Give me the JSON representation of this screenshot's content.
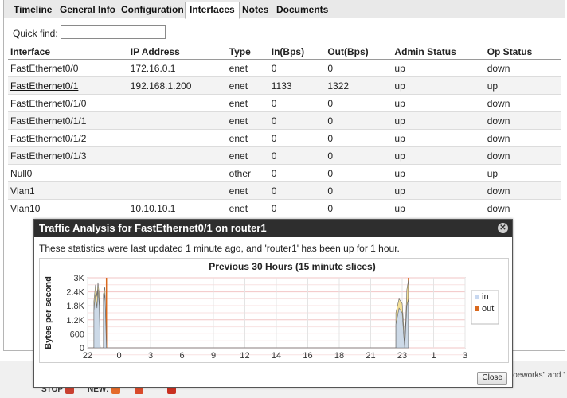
{
  "tabs": [
    {
      "label": "Timeline"
    },
    {
      "label": "General Info"
    },
    {
      "label": "Configuration"
    },
    {
      "label": "Interfaces",
      "active": true
    },
    {
      "label": "Notes"
    },
    {
      "label": "Documents"
    }
  ],
  "quickfind": {
    "label": "Quick find:",
    "value": ""
  },
  "table": {
    "headers": [
      "Interface",
      "IP Address",
      "Type",
      "In(Bps)",
      "Out(Bps)",
      "Admin Status",
      "Op Status"
    ],
    "rows": [
      [
        "FastEthernet0/0",
        "172.16.0.1",
        "enet",
        "0",
        "0",
        "up",
        "down"
      ],
      [
        "FastEthernet0/1",
        "192.168.1.200",
        "enet",
        "1133",
        "1322",
        "up",
        "up"
      ],
      [
        "FastEthernet0/1/0",
        "",
        "enet",
        "0",
        "0",
        "up",
        "down"
      ],
      [
        "FastEthernet0/1/1",
        "",
        "enet",
        "0",
        "0",
        "up",
        "down"
      ],
      [
        "FastEthernet0/1/2",
        "",
        "enet",
        "0",
        "0",
        "up",
        "down"
      ],
      [
        "FastEthernet0/1/3",
        "",
        "enet",
        "0",
        "0",
        "up",
        "down"
      ],
      [
        "Null0",
        "",
        "other",
        "0",
        "0",
        "up",
        "up"
      ],
      [
        "Vlan1",
        "",
        "enet",
        "0",
        "0",
        "up",
        "down"
      ],
      [
        "Vlan10",
        "10.10.10.1",
        "enet",
        "0",
        "0",
        "up",
        "down"
      ]
    ]
  },
  "modal": {
    "title": "Traffic Analysis for FastEthernet0/1 on router1",
    "status_text": "These statistics were last updated 1 minute ago, and 'router1' has been up for 1 hour.",
    "close_label": "Close"
  },
  "statusbar": {
    "stop_label": "STOP",
    "new_label": "NEW:",
    "right_text": "ioeworks\" and '"
  },
  "colors": {
    "in": "#c8d8f0",
    "out": "#f2dc8c",
    "marker": "#d9691e",
    "grid": "#f2c6c6"
  },
  "chart_data": {
    "type": "area",
    "title": "Previous 30 Hours (15 minute slices)",
    "xlabel": "",
    "ylabel": "Bytes per second",
    "yticks": [
      "0",
      "600",
      "1.2K",
      "1.8K",
      "2.4K",
      "3K"
    ],
    "ylim": [
      0,
      3000
    ],
    "xticks": [
      "22",
      "0",
      "3",
      "6",
      "9",
      "12",
      "14",
      "16",
      "18",
      "21",
      "23",
      "1",
      "3"
    ],
    "grid": true,
    "legend_position": "right",
    "series": [
      {
        "name": "in",
        "color": "#c8d8f0",
        "points": [
          [
            0,
            0
          ],
          [
            0.2,
            0
          ],
          [
            0.2,
            1600
          ],
          [
            0.25,
            2300
          ],
          [
            0.3,
            1700
          ],
          [
            0.33,
            2500
          ],
          [
            0.37,
            1800
          ],
          [
            0.4,
            0
          ],
          [
            0.5,
            0
          ],
          [
            0.5,
            1700
          ],
          [
            0.55,
            2350
          ],
          [
            0.6,
            0
          ],
          [
            9.8,
            0
          ],
          [
            9.8,
            1000
          ],
          [
            9.9,
            1700
          ],
          [
            10,
            1500
          ],
          [
            10.05,
            500
          ],
          [
            10.08,
            0
          ],
          [
            10.15,
            1800
          ],
          [
            10.2,
            2100
          ]
        ]
      },
      {
        "name": "out",
        "color": "#d9691e",
        "points": [
          [
            0,
            0
          ],
          [
            0.2,
            0
          ],
          [
            0.2,
            2000
          ],
          [
            0.25,
            2700
          ],
          [
            0.3,
            2200
          ],
          [
            0.33,
            2800
          ],
          [
            0.37,
            2300
          ],
          [
            0.4,
            0
          ],
          [
            0.5,
            0
          ],
          [
            0.5,
            2300
          ],
          [
            0.55,
            2600
          ],
          [
            0.6,
            0
          ],
          [
            9.8,
            0
          ],
          [
            9.8,
            1500
          ],
          [
            9.9,
            2100
          ],
          [
            10,
            1900
          ],
          [
            10.05,
            900
          ],
          [
            10.08,
            0
          ],
          [
            10.15,
            2500
          ],
          [
            10.2,
            2900
          ]
        ]
      }
    ]
  }
}
